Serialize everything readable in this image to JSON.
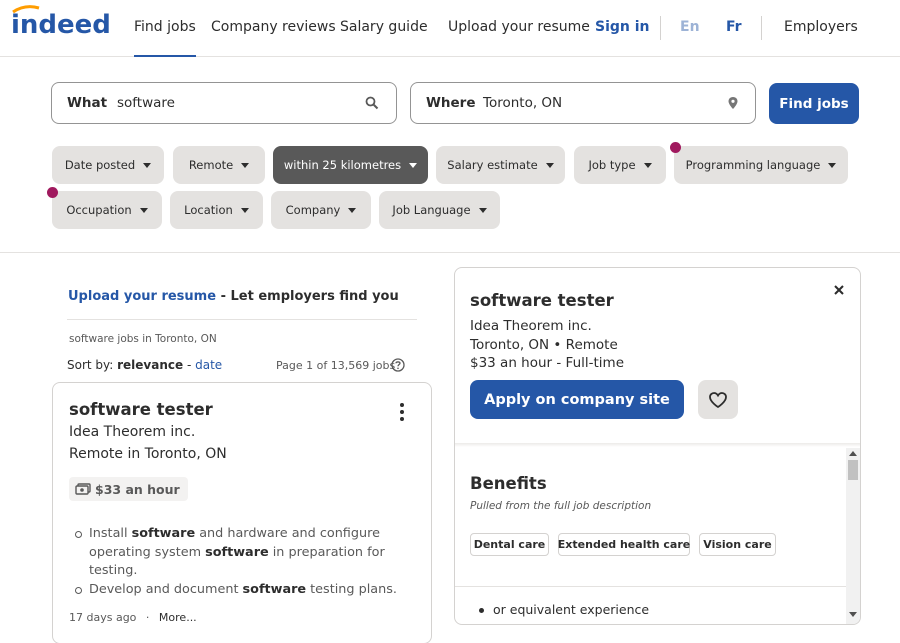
{
  "header": {
    "logo_text": "indeed",
    "nav": [
      "Find jobs",
      "Company reviews",
      "Salary guide",
      "Upload your resume"
    ],
    "sign_in": "Sign in",
    "lang_en": "En",
    "lang_fr": "Fr",
    "employers": "Employers"
  },
  "search": {
    "what_label": "What",
    "what_value": "software",
    "where_label": "Where",
    "where_value": "Toronto, ON",
    "find_button": "Find jobs"
  },
  "filters": [
    "Date posted",
    "Remote",
    "within 25 kilometres",
    "Salary estimate",
    "Job type",
    "Programming language",
    "Occupation",
    "Location",
    "Company",
    "Job Language"
  ],
  "left": {
    "upload_link": "Upload your resume",
    "upload_tail": " - Let employers find you",
    "breadcrumb": "software jobs in Toronto, ON",
    "sort_prefix": "Sort by: ",
    "sort_relevance": "relevance",
    "sort_sep": " - ",
    "sort_date": "date",
    "page_info": "Page 1 of 13,569 jobs"
  },
  "job_card": {
    "title": "software tester",
    "company": "Idea Theorem inc.",
    "location": "Remote in Toronto, ON",
    "salary": "$33 an hour",
    "snippet": {
      "s1": "Install ",
      "s2": "software",
      "s3": " and hardware and configure operating system ",
      "s4": "software",
      "s5": " in preparation for testing.",
      "t1": "Develop and document ",
      "t2": "software",
      "t3": " testing plans."
    },
    "posted": "17 days ago",
    "dot": "·",
    "more": "More..."
  },
  "detail": {
    "title": "software tester",
    "company": "Idea Theorem inc.",
    "location": "Toronto, ON  •  Remote",
    "pay": "$33 an hour  - Full-time",
    "apply_button": "Apply on company site",
    "benefits_title": "Benefits",
    "benefits_sub": "Pulled from the full job description",
    "benefits": [
      "Dental care",
      "Extended health care",
      "Vision care"
    ],
    "bullet": "or equivalent experience"
  },
  "colors": {
    "brand_blue": "#2557a7",
    "active_chip": "#595959",
    "chip_bg": "#e4e2e0",
    "dot": "#a0195e"
  }
}
